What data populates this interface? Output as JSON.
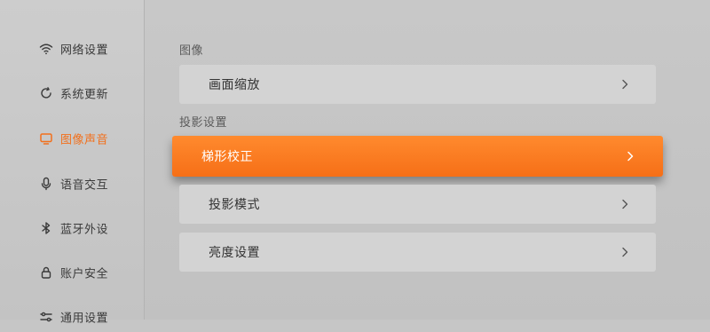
{
  "sidebar": {
    "items": [
      {
        "label": "网络设置",
        "icon": "wifi-icon"
      },
      {
        "label": "系统更新",
        "icon": "refresh-icon"
      },
      {
        "label": "图像声音",
        "icon": "monitor-icon"
      },
      {
        "label": "语音交互",
        "icon": "microphone-icon"
      },
      {
        "label": "蓝牙外设",
        "icon": "bluetooth-icon"
      },
      {
        "label": "账户安全",
        "icon": "lock-icon"
      },
      {
        "label": "通用设置",
        "icon": "sliders-icon"
      }
    ],
    "active_index": 2
  },
  "main": {
    "sections": [
      {
        "title": "图像",
        "items": [
          {
            "label": "画面缩放"
          }
        ]
      },
      {
        "title": "投影设置",
        "items": [
          {
            "label": "梯形校正",
            "focused": true
          },
          {
            "label": "投影模式"
          },
          {
            "label": "亮度设置"
          }
        ]
      }
    ]
  },
  "colors": {
    "accent": "#f6761c",
    "background": "#c6c6c6",
    "row_background": "#d3d3d3",
    "text": "#333333"
  },
  "icons": {
    "chevron": "chevron-right-icon"
  }
}
